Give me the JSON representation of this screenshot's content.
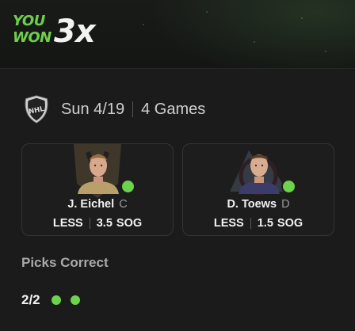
{
  "header": {
    "you_won_line1": "YOU",
    "you_won_line2": "WON",
    "multiplier": "3x"
  },
  "game": {
    "league": "NHL",
    "league_icon": "nhl-shield-logo",
    "date": "Sun 4/19",
    "games_count": "4 Games"
  },
  "picks": [
    {
      "name": "J. Eichel",
      "position": "C",
      "direction": "LESS",
      "line": "3.5",
      "stat": "SOG",
      "result": "correct"
    },
    {
      "name": "D. Toews",
      "position": "D",
      "direction": "LESS",
      "line": "1.5",
      "stat": "SOG",
      "result": "correct"
    }
  ],
  "summary": {
    "label": "Picks Correct",
    "score": "2/2",
    "results": [
      "correct",
      "correct"
    ]
  },
  "colors": {
    "accent_green": "#6dd34b",
    "background": "#1b1b1b",
    "text_primary": "#f2f2f2",
    "text_secondary": "#a9a9a9"
  }
}
